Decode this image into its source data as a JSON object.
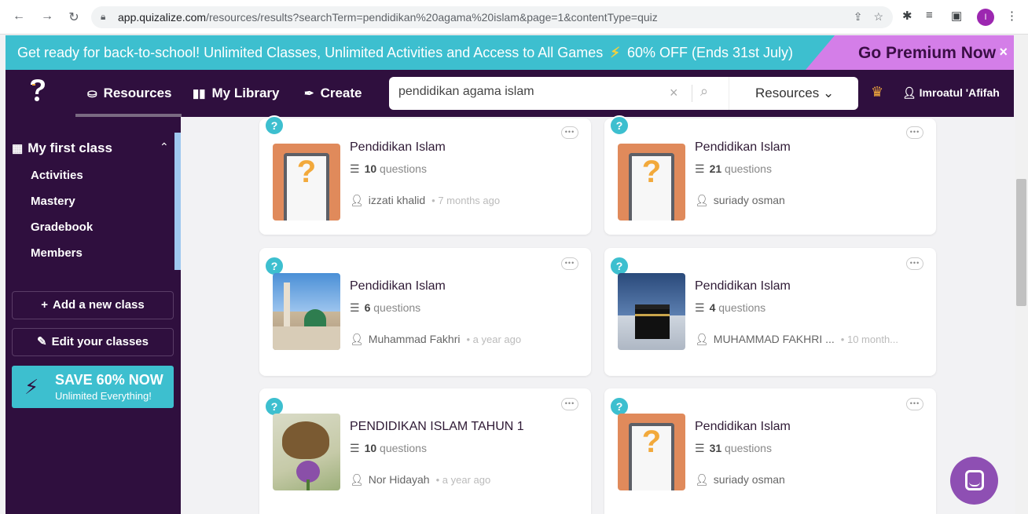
{
  "browser": {
    "url_host": "app.quizalize.com",
    "url_path": "/resources/results?searchTerm=pendidikan%20agama%20islam&page=1&contentType=quiz",
    "profile_initial": "I",
    "icons": [
      "back-arrow-icon",
      "forward-arrow-icon",
      "reload-icon",
      "lock-icon",
      "share-icon",
      "star-icon",
      "extensions-icon",
      "reading-list-icon",
      "side-panel-icon",
      "more-vert-icon"
    ]
  },
  "promo": {
    "text": "Get ready for back-to-school!  Unlimited Classes, Unlimited Activities and Access to All Games",
    "offer": "60% OFF (Ends 31st July)",
    "premium": "Go Premium Now",
    "close": "×"
  },
  "header": {
    "nav": [
      {
        "label": "Resources",
        "icon": "binoculars-icon"
      },
      {
        "label": "My Library",
        "icon": "book-icon"
      },
      {
        "label": "Create",
        "icon": "pen-icon"
      }
    ],
    "search_value": "pendidikan agama islam",
    "search_type": "Resources",
    "user_name": "Imroatul 'Afifah"
  },
  "sidebar": {
    "class_name": "My first class",
    "items": [
      {
        "label": "Activities"
      },
      {
        "label": "Mastery"
      },
      {
        "label": "Gradebook"
      },
      {
        "label": "Members"
      }
    ],
    "add_class": "Add a new class",
    "edit_classes": "Edit your classes",
    "save_title": "SAVE 60% NOW",
    "save_sub": "Unlimited Everything!"
  },
  "cards": [
    {
      "title": "Pendidikan Islam",
      "count": "10",
      "unit": "questions",
      "author": "izzati khalid",
      "time": "7 months ago",
      "thumb": "phone"
    },
    {
      "title": "Pendidikan Islam",
      "count": "21",
      "unit": "questions",
      "author": "suriady osman",
      "time": "",
      "thumb": "phone"
    },
    {
      "title": "Pendidikan Islam",
      "count": "6",
      "unit": "questions",
      "author": "Muhammad Fakhri",
      "time": "a year ago",
      "thumb": "mosque"
    },
    {
      "title": "Pendidikan Islam",
      "count": "4",
      "unit": "questions",
      "author": "MUHAMMAD FAKHRI ...",
      "time": "10 month...",
      "thumb": "kaaba"
    },
    {
      "title": "PENDIDIKAN ISLAM TAHUN 1",
      "count": "10",
      "unit": "questions",
      "author": "Nor Hidayah",
      "time": "a year ago",
      "thumb": "butterfly"
    },
    {
      "title": "Pendidikan Islam",
      "count": "31",
      "unit": "questions",
      "author": "suriady osman",
      "time": "",
      "thumb": "phone"
    }
  ],
  "colors": {
    "brand_purple": "#2f0f3e",
    "teal": "#3dbfcf",
    "premium_pink": "#d47ee8",
    "orange": "#f2a93b"
  }
}
